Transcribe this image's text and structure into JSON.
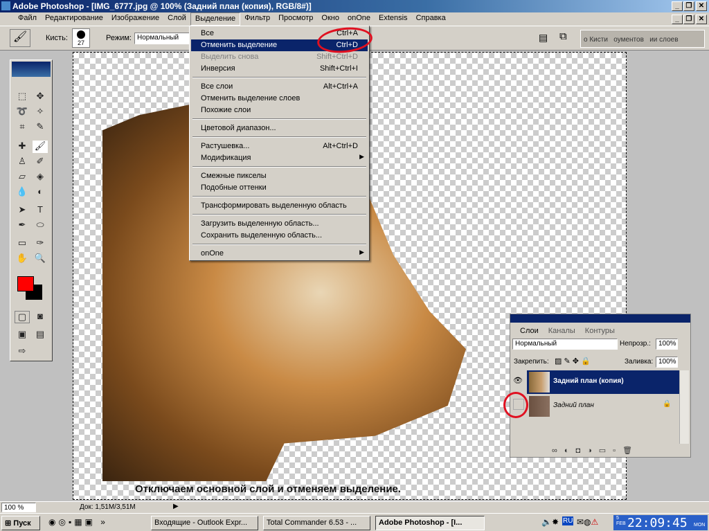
{
  "title": "Adobe Photoshop - [IMG_6777.jpg @ 100% (Задний план (копия), RGB/8#)]",
  "menubar": [
    "Файл",
    "Редактирование",
    "Изображение",
    "Слой",
    "Выделение",
    "Фильтр",
    "Просмотр",
    "Окно",
    "onOne",
    "Extensis",
    "Справка"
  ],
  "options": {
    "brush_label": "Кисть:",
    "brush_size": "27",
    "mode_label": "Режим:",
    "mode_value": "Нормальный",
    "palette_tabs": "о Кисти   оументов   ии слоев"
  },
  "select_menu": [
    {
      "label": "Все",
      "shortcut": "Ctrl+A"
    },
    {
      "label": "Отменить выделение",
      "shortcut": "Ctrl+D",
      "highlighted": true
    },
    {
      "label": "Выделить снова",
      "shortcut": "Shift+Ctrl+D",
      "disabled": true
    },
    {
      "label": "Инверсия",
      "shortcut": "Shift+Ctrl+I"
    },
    {
      "label": "Все слои",
      "shortcut": "Alt+Ctrl+A"
    },
    {
      "label": "Отменить выделение слоев",
      "shortcut": ""
    },
    {
      "label": "Похожие слои",
      "shortcut": ""
    },
    {
      "label": "Цветовой диапазон...",
      "shortcut": ""
    },
    {
      "label": "Растушевка...",
      "shortcut": "Alt+Ctrl+D"
    },
    {
      "label": "Модификация",
      "shortcut": "",
      "submenu": true
    },
    {
      "label": "Смежные пикселы",
      "shortcut": ""
    },
    {
      "label": "Подобные оттенки",
      "shortcut": ""
    },
    {
      "label": "Трансформировать выделенную область",
      "shortcut": ""
    },
    {
      "label": "Загрузить выделенную область...",
      "shortcut": ""
    },
    {
      "label": "Сохранить выделенную область...",
      "shortcut": ""
    },
    {
      "label": "onOne",
      "shortcut": "",
      "submenu": true
    }
  ],
  "caption": "Отключаем основной слой и отменяем выделение.",
  "layers": {
    "tabs": [
      "Слои",
      "Каналы",
      "Контуры"
    ],
    "blend_mode": "Нормальный",
    "opacity_label": "Непрозр.:",
    "opacity": "100%",
    "lock_label": "Закрепить:",
    "fill_label": "Заливка:",
    "fill": "100%",
    "items": [
      {
        "name": "Задний план (копия)",
        "visible": true,
        "selected": true
      },
      {
        "name": "Задний план",
        "visible": false,
        "locked": true
      }
    ]
  },
  "status": {
    "zoom": "100 %",
    "doc": "Док: 1,51M/3,51M"
  },
  "taskbar": {
    "start": "Пуск",
    "tasks": [
      "Входящие - Outlook Expr...",
      "Total Commander 6.53 - ...",
      "Adobe Photoshop - [I..."
    ],
    "lang": "RU",
    "time": "22:09:45",
    "date_day": "5",
    "date_month": "FEB",
    "weekday": "MON"
  },
  "colors": {
    "foreground": "#ff0000",
    "background": "#000000",
    "highlight": "#0a246a",
    "annotation": "#e01020"
  }
}
